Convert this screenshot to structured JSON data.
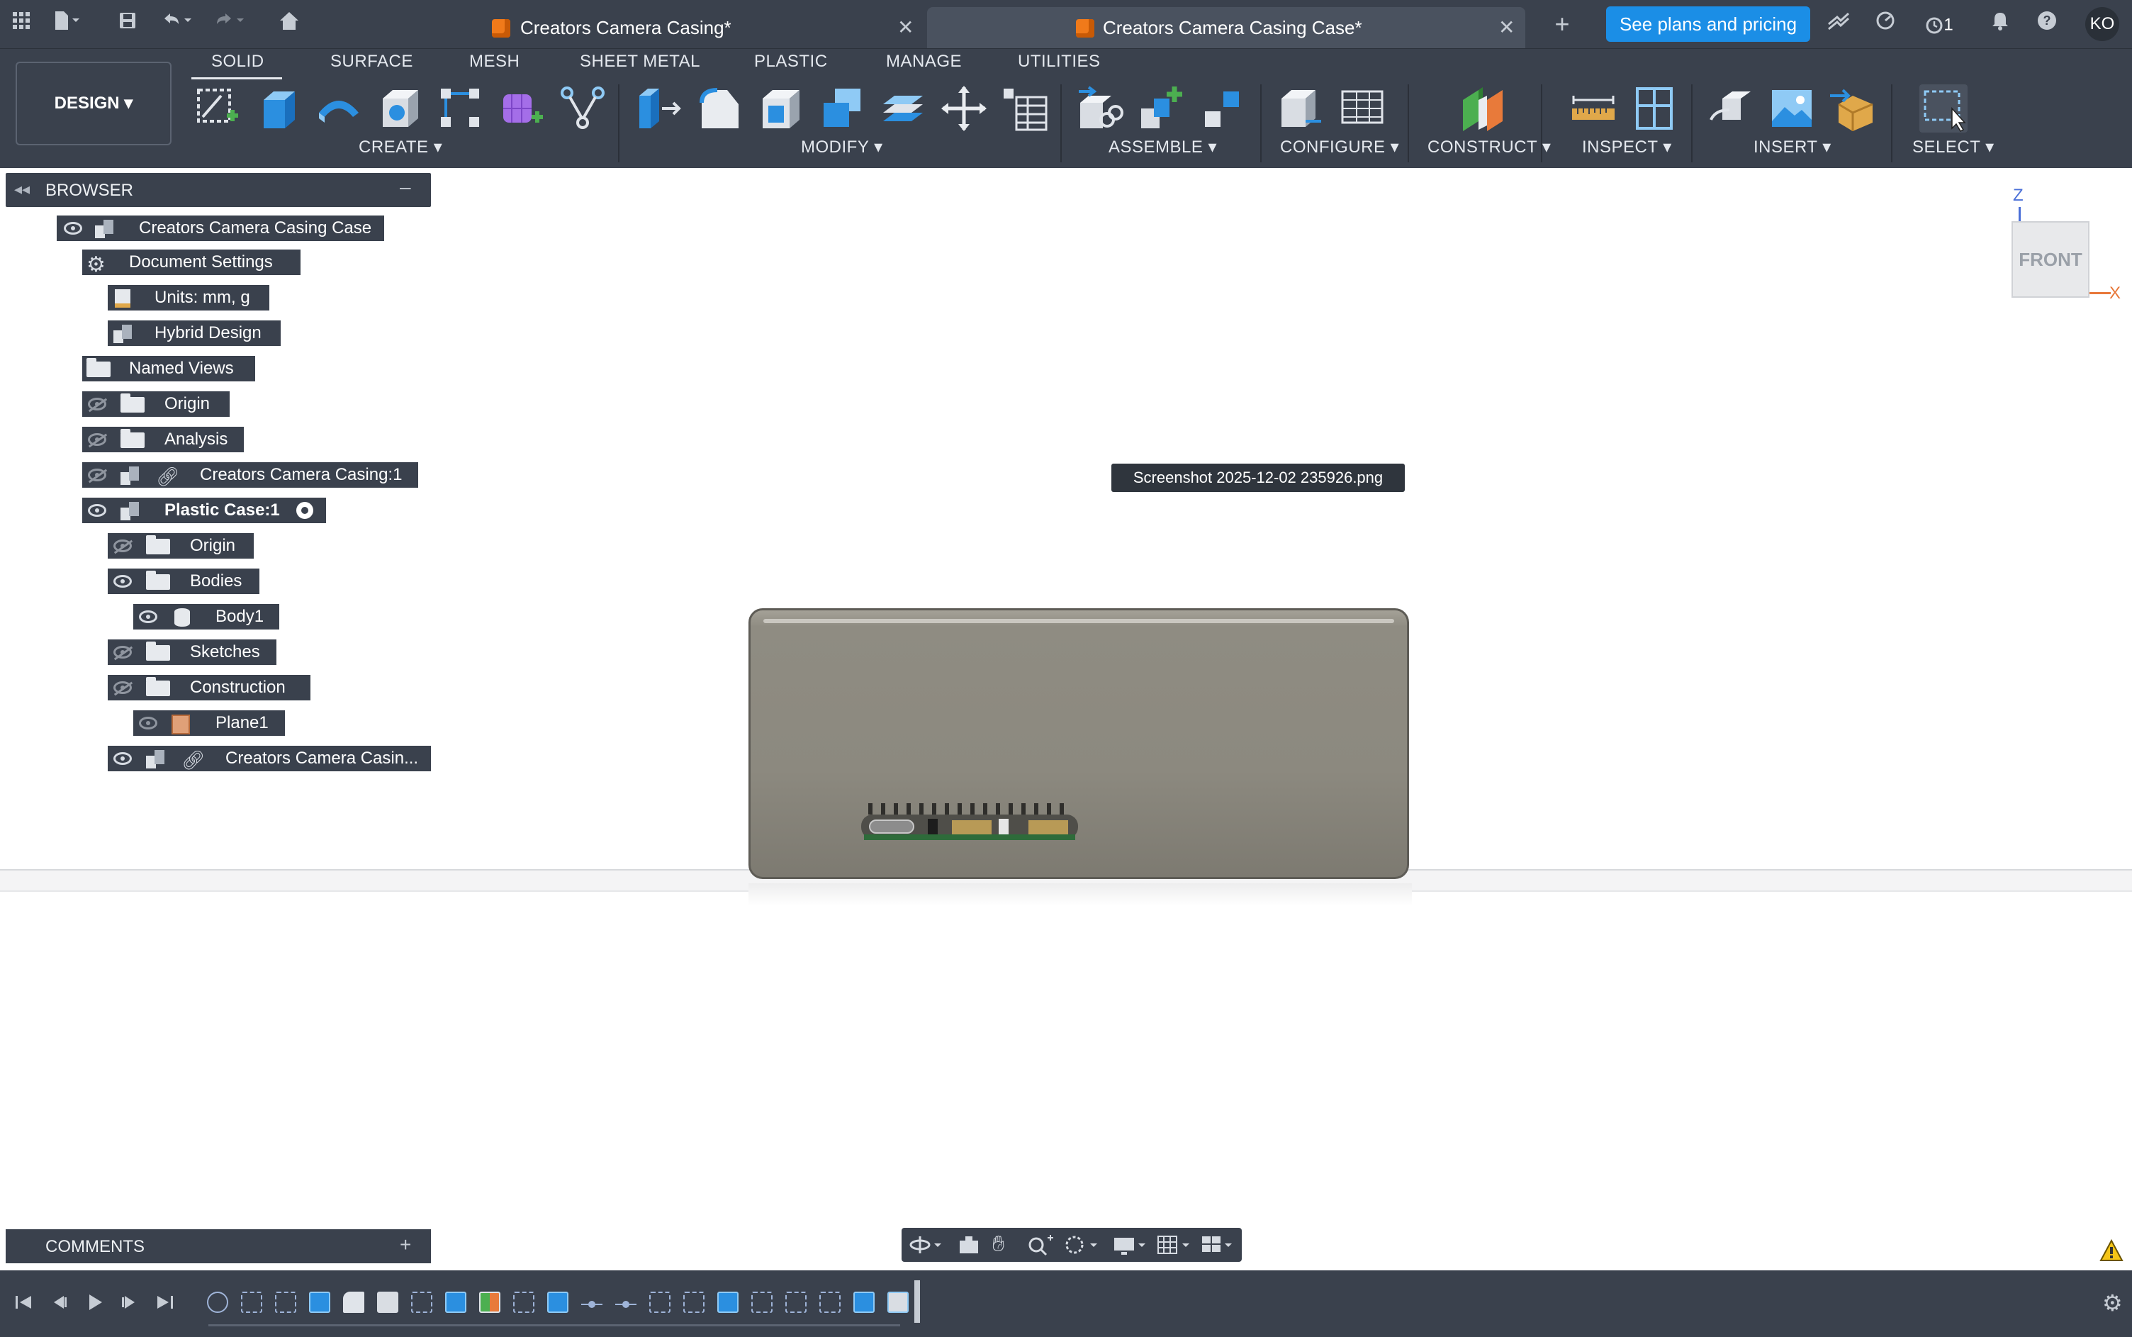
{
  "titlebar": {
    "tabs": [
      {
        "label": "Creators Camera Casing*",
        "active": false
      },
      {
        "label": "Creators Camera Casing Case*",
        "active": true
      }
    ],
    "plans_button": "See plans and pricing",
    "job_count": "1",
    "avatar_initials": "KO",
    "icons": [
      "apps-grid-icon",
      "file-icon",
      "save-icon",
      "undo-icon",
      "redo-icon",
      "home-icon",
      "new-tab-icon",
      "extensions-icon",
      "job-status-icon",
      "notifications-icon",
      "help-icon"
    ]
  },
  "toolbar": {
    "workspace": "DESIGN",
    "tabs": [
      "SOLID",
      "SURFACE",
      "MESH",
      "SHEET METAL",
      "PLASTIC",
      "MANAGE",
      "UTILITIES"
    ],
    "active_tab": "SOLID",
    "groups": [
      "CREATE",
      "MODIFY",
      "ASSEMBLE",
      "CONFIGURE",
      "CONSTRUCT",
      "INSPECT",
      "INSERT",
      "SELECT"
    ]
  },
  "browser": {
    "title": "BROWSER",
    "root": "Creators Camera Casing Case",
    "items": {
      "document_settings": "Document Settings",
      "units": "Units: mm, g",
      "hybrid_design": "Hybrid Design",
      "named_views": "Named Views",
      "origin": "Origin",
      "analysis": "Analysis",
      "linked_component": "Creators Camera Casing:1",
      "plastic_case": "Plastic Case:1",
      "pc_origin": "Origin",
      "bodies": "Bodies",
      "body1": "Body1",
      "sketches": "Sketches",
      "construction": "Construction",
      "plane1": "Plane1",
      "linked_sub": "Creators Camera Casin..."
    }
  },
  "viewport": {
    "tooltip": "Screenshot 2025-12-02 235926.png",
    "viewcube_face": "FRONT",
    "axis_z": "Z",
    "axis_x": "X"
  },
  "comments": {
    "title": "COMMENTS"
  },
  "colors": {
    "chrome": "#3a414d",
    "accent": "#1b8ee6",
    "orange": "#f07a1a"
  }
}
